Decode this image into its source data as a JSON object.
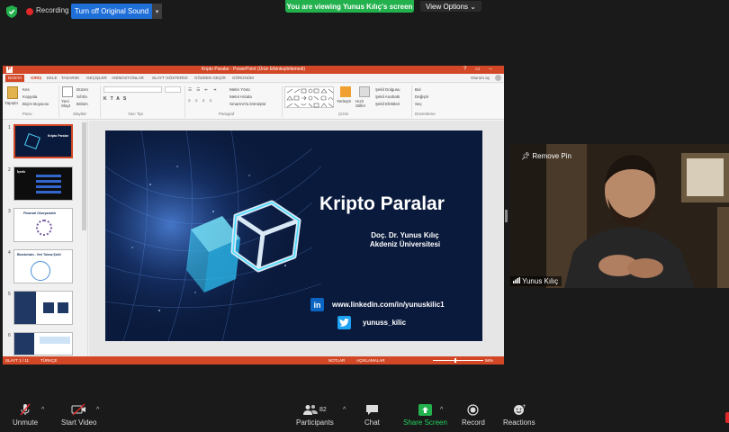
{
  "topbar": {
    "recording_label": "Recording",
    "sound_button": "Turn off Original Sound",
    "sound_caret": "▾",
    "viewing_banner": "You are viewing Yunus Kılıç's screen",
    "view_options": "View Options ⌄"
  },
  "ppt": {
    "window_title": "Kripto Paralar  -  PowerPoint (Ürün Etkinleştirilemedi)",
    "window_controls": "? ▭ – □ ✕",
    "user": "Oturum aç",
    "tabs": [
      "DOSYA",
      "GİRİŞ",
      "EKLE",
      "TASARIM",
      "GEÇİŞLER",
      "ANİMASYONLAR",
      "SLAYT GÖSTERİSİ",
      "GÖZDEN GEÇİR",
      "GÖRÜNÜM"
    ],
    "ribbon": {
      "paste": "Yapıştır",
      "cut": "Kes",
      "copy": "Kopyala",
      "format_painter": "Biçim Boyacısı",
      "new_slide": "Yeni Slayt",
      "layout": "Düzen",
      "reset": "Sıfırla",
      "section": "Bölüm",
      "text_direction": "Metin Yönü",
      "align_text": "Metni Hizala",
      "smartart": "SmartArt'a Dönüştür",
      "arrange": "Yerleştir",
      "quick_styles": "Hızlı Stiller",
      "shape_fill": "Şekil Dolgusu",
      "shape_outline": "Şekil Anahattı",
      "shape_effects": "Şekil Efektleri",
      "find": "Bul",
      "replace": "Değiştir",
      "select": "Seç",
      "group_clipboard": "Pano",
      "group_slides": "Slaytlar",
      "group_font": "Yazı Tipi",
      "group_paragraph": "Paragraf",
      "group_drawing": "Çizim",
      "group_editing": "Düzenleme"
    },
    "thumbnails": [
      {
        "num": "1",
        "title": "Kripto Paralar"
      },
      {
        "num": "2",
        "title": "İçerik"
      },
      {
        "num": "3",
        "title": "Finansal Okuryazarlık"
      },
      {
        "num": "4",
        "title": "Blockchain - Veri Tutma Şekli"
      },
      {
        "num": "5",
        "title": ""
      },
      {
        "num": "6",
        "title": ""
      }
    ],
    "slide": {
      "title": "Kripto Paralar",
      "author_line1": "Doç. Dr. Yunus Kılıç",
      "author_line2": "Akdeniz Üniversitesi",
      "linkedin_icon": "in",
      "linkedin": "www.linkedin.com/in/yunuskilic1",
      "twitter": "yunuss_kilic"
    },
    "status": {
      "slide_count": "SLAYT 1 / 11",
      "language": "TÜRKÇE",
      "notes": "NOTLAR",
      "comments": "AÇIKLAMALAR",
      "zoom": "56%"
    }
  },
  "video": {
    "remove_pin": "Remove Pin",
    "participant_name": "Yunus Kılıç"
  },
  "toolbar": {
    "unmute": "Unmute",
    "start_video": "Start Video",
    "participants": "Participants",
    "participants_count": "82",
    "chat": "Chat",
    "share_screen": "Share Screen",
    "record": "Record",
    "reactions": "Reactions",
    "caret": "^"
  },
  "colors": {
    "zoom_blue": "#1f6fd9",
    "zoom_green": "#23b14d",
    "ppt_orange": "#d24726",
    "slide_navy": "#0a1a3c"
  }
}
